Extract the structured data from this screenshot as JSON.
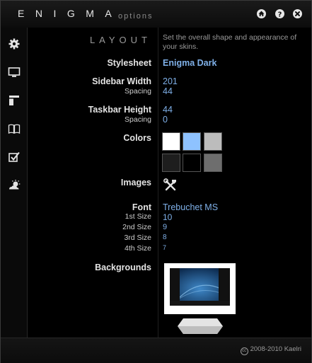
{
  "app": {
    "title": "ENIGMA",
    "subtitle": "options"
  },
  "section": {
    "heading": "LAYOUT",
    "description": "Set the overall shape and appearance of your skins."
  },
  "settings": {
    "stylesheet_label": "Stylesheet",
    "stylesheet_value": "Enigma Dark",
    "sidebar_width_label": "Sidebar Width",
    "sidebar_width_value": "201",
    "sidebar_spacing_label": "Spacing",
    "sidebar_spacing_value": "44",
    "taskbar_height_label": "Taskbar Height",
    "taskbar_height_value": "44",
    "taskbar_spacing_label": "Spacing",
    "taskbar_spacing_value": "0",
    "colors_label": "Colors",
    "colors": [
      "#ffffff",
      "#8ec2ff",
      "#bcbcbc",
      "#1e1e1e",
      "#000000",
      "#6e6e6e"
    ],
    "images_label": "Images",
    "images_icon": "tools-icon",
    "font_label": "Font",
    "font_value": "Trebuchet MS",
    "size1_label": "1st Size",
    "size1_value": "10",
    "size2_label": "2nd Size",
    "size2_value": "9",
    "size3_label": "3rd Size",
    "size3_value": "8",
    "size4_label": "4th Size",
    "size4_value": "7",
    "backgrounds_label": "Backgrounds"
  },
  "sidebar": {
    "items": [
      {
        "icon": "gear-icon"
      },
      {
        "icon": "monitor-icon",
        "selected": true
      },
      {
        "icon": "layout-icon"
      },
      {
        "icon": "book-icon"
      },
      {
        "icon": "checkbox-icon"
      },
      {
        "icon": "weather-icon"
      }
    ]
  },
  "titlebar": {
    "buttons": [
      "home-icon",
      "help-icon",
      "close-icon"
    ]
  },
  "footer": {
    "copyright": "2008-2010 Kaelri"
  }
}
